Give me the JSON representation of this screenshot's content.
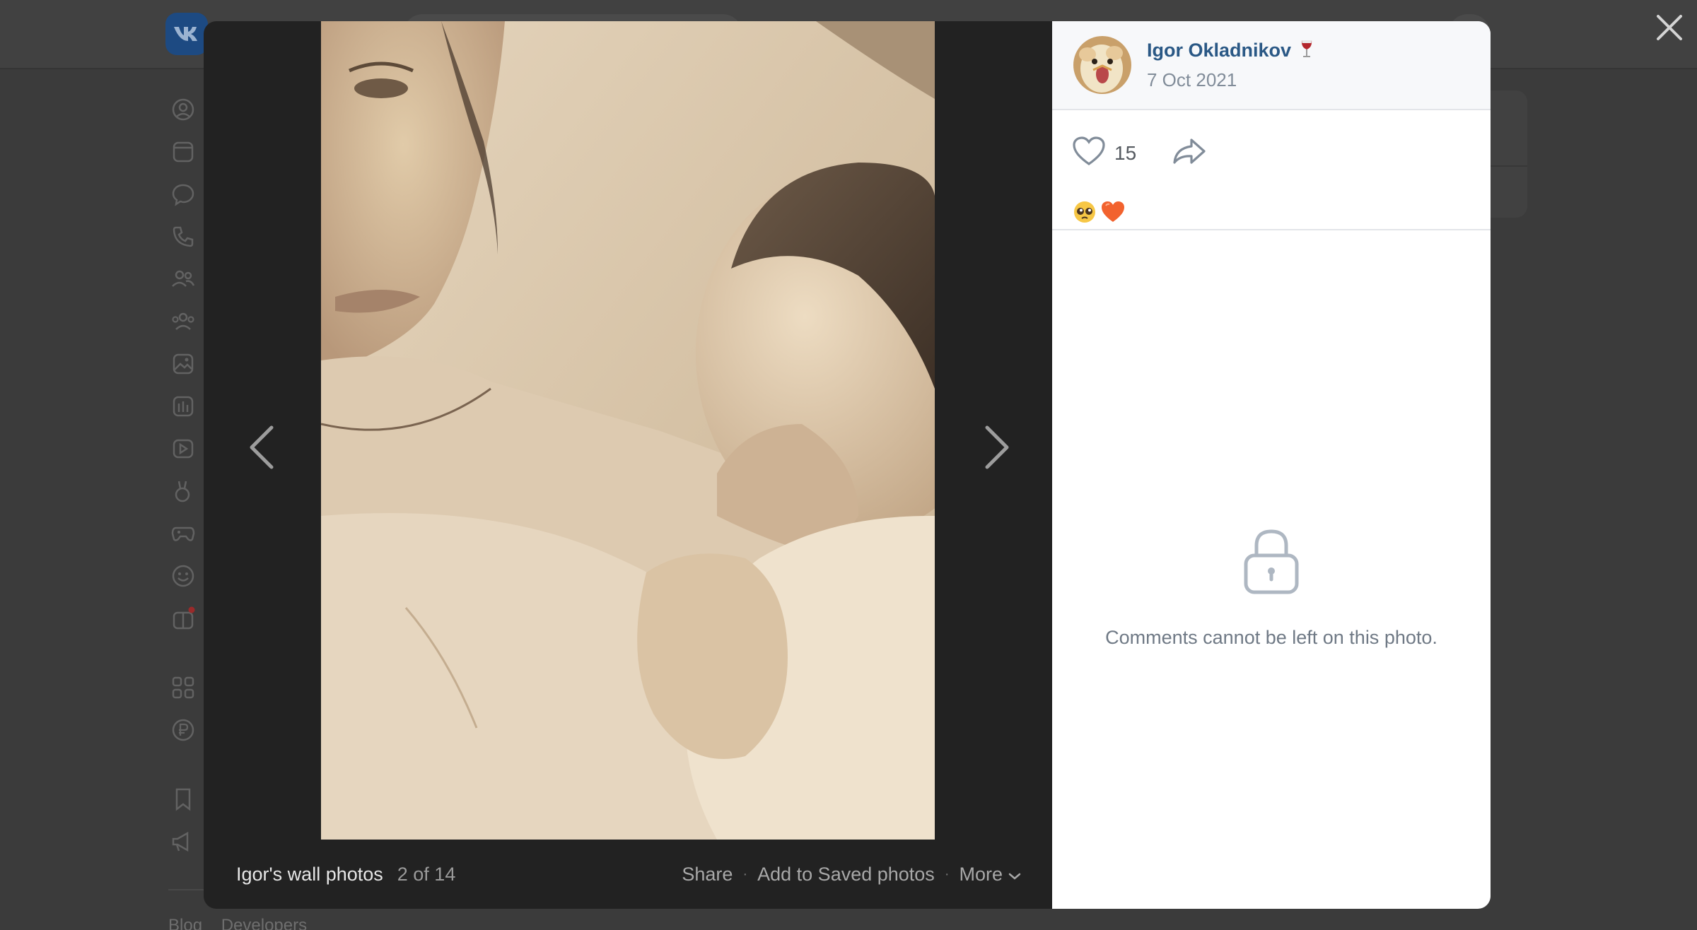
{
  "viewer": {
    "album_title": "Igor's wall photos",
    "counter": "2 of 14",
    "actions": {
      "share": "Share",
      "add_saved": "Add to Saved photos",
      "more": "More"
    }
  },
  "post": {
    "author_name": "Igor Okladnikov",
    "author_emoji": "wine-glass",
    "date": "7 Oct 2021",
    "likes": "15",
    "reactions": [
      "pleading-face",
      "orange-heart"
    ]
  },
  "comments": {
    "locked_text": "Comments cannot be left on this photo."
  },
  "background": {
    "footer_links": [
      "Blog",
      "Developers"
    ]
  },
  "colors": {
    "author_link": "#2a5885",
    "viewer_bg": "#222222",
    "overlay_bg": "#3a3a3a"
  }
}
